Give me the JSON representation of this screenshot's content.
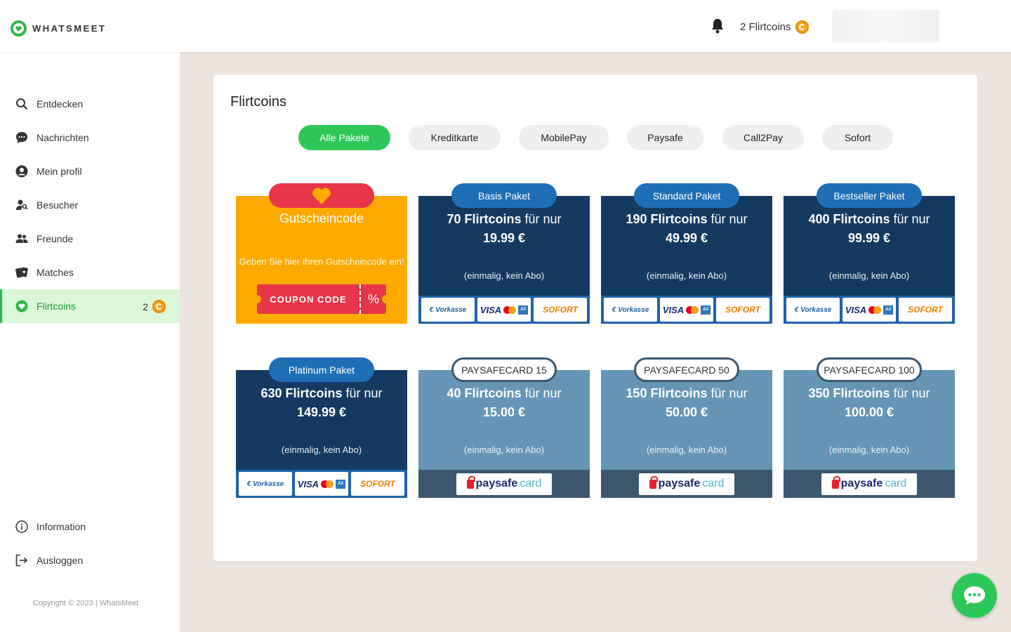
{
  "header": {
    "logo_text": "WHATSMEET",
    "coins_label": "2 Flirtcoins"
  },
  "sidebar": {
    "items": [
      {
        "label": "Entdecken",
        "icon": "search-icon"
      },
      {
        "label": "Nachrichten",
        "icon": "chat-icon"
      },
      {
        "label": "Mein profil",
        "icon": "user-icon"
      },
      {
        "label": "Besucher",
        "icon": "visitor-icon"
      },
      {
        "label": "Freunde",
        "icon": "friends-icon"
      },
      {
        "label": "Matches",
        "icon": "matches-icon"
      },
      {
        "label": "Flirtcoins",
        "icon": "heart-icon",
        "badge": "2",
        "active": true
      }
    ],
    "bottom": [
      {
        "label": "Information",
        "icon": "info-icon"
      },
      {
        "label": "Ausloggen",
        "icon": "logout-icon"
      }
    ],
    "copyright": "Copyright © 2023 | WhatsMeet"
  },
  "main": {
    "title": "Flirtcoins",
    "filters": [
      "Alle Pakete",
      "Kreditkarte",
      "MobilePay",
      "Paysafe",
      "Call2Pay",
      "Sofort"
    ],
    "voucher": {
      "title": "Gutscheincode",
      "note": "Geben Sie hier Ihren Gutscheincode ein!",
      "coupon": "COUPON CODE",
      "percent": "%"
    },
    "packages": [
      {
        "tag": "Basis Paket",
        "coins": "70 Flirtcoins",
        "for": "für nur",
        "price": "19.99 €",
        "note": "(einmalig, kein Abo)"
      },
      {
        "tag": "Standard Paket",
        "coins": "190 Flirtcoins",
        "for": "für nur",
        "price": "49.99 €",
        "note": "(einmalig, kein Abo)"
      },
      {
        "tag": "Bestseller Paket",
        "coins": "400 Flirtcoins",
        "for": "für nur",
        "price": "99.99 €",
        "note": "(einmalig, kein Abo)"
      },
      {
        "tag": "Platinum Paket",
        "coins": "630 Flirtcoins",
        "for": "für nur",
        "price": "149.99 €",
        "note": "(einmalig, kein Abo)"
      },
      {
        "tag": "PAYSAFECARD 15",
        "coins": "40 Flirtcoins",
        "for": "für nur",
        "price": "15.00 €",
        "note": "(einmalig, kein Abo)"
      },
      {
        "tag": "PAYSAFECARD 50",
        "coins": "150 Flirtcoins",
        "for": "für nur",
        "price": "50.00 €",
        "note": "(einmalig, kein Abo)"
      },
      {
        "tag": "PAYSAFECARD 100",
        "coins": "350 Flirtcoins",
        "for": "für nur",
        "price": "100.00 €",
        "note": "(einmalig, kein Abo)"
      }
    ],
    "pay_logos": {
      "vorkasse": "Vorkasse",
      "visa": "VISA",
      "sofort": "SOFORT",
      "paysafe_a": "paysafe",
      "paysafe_b": "card"
    }
  },
  "colors": {
    "accent": "#2ec85a",
    "dark_card": "#143a62",
    "light_card": "#6596b6",
    "voucher": "#fdaa00",
    "tag_blue": "#1f6fb7"
  }
}
